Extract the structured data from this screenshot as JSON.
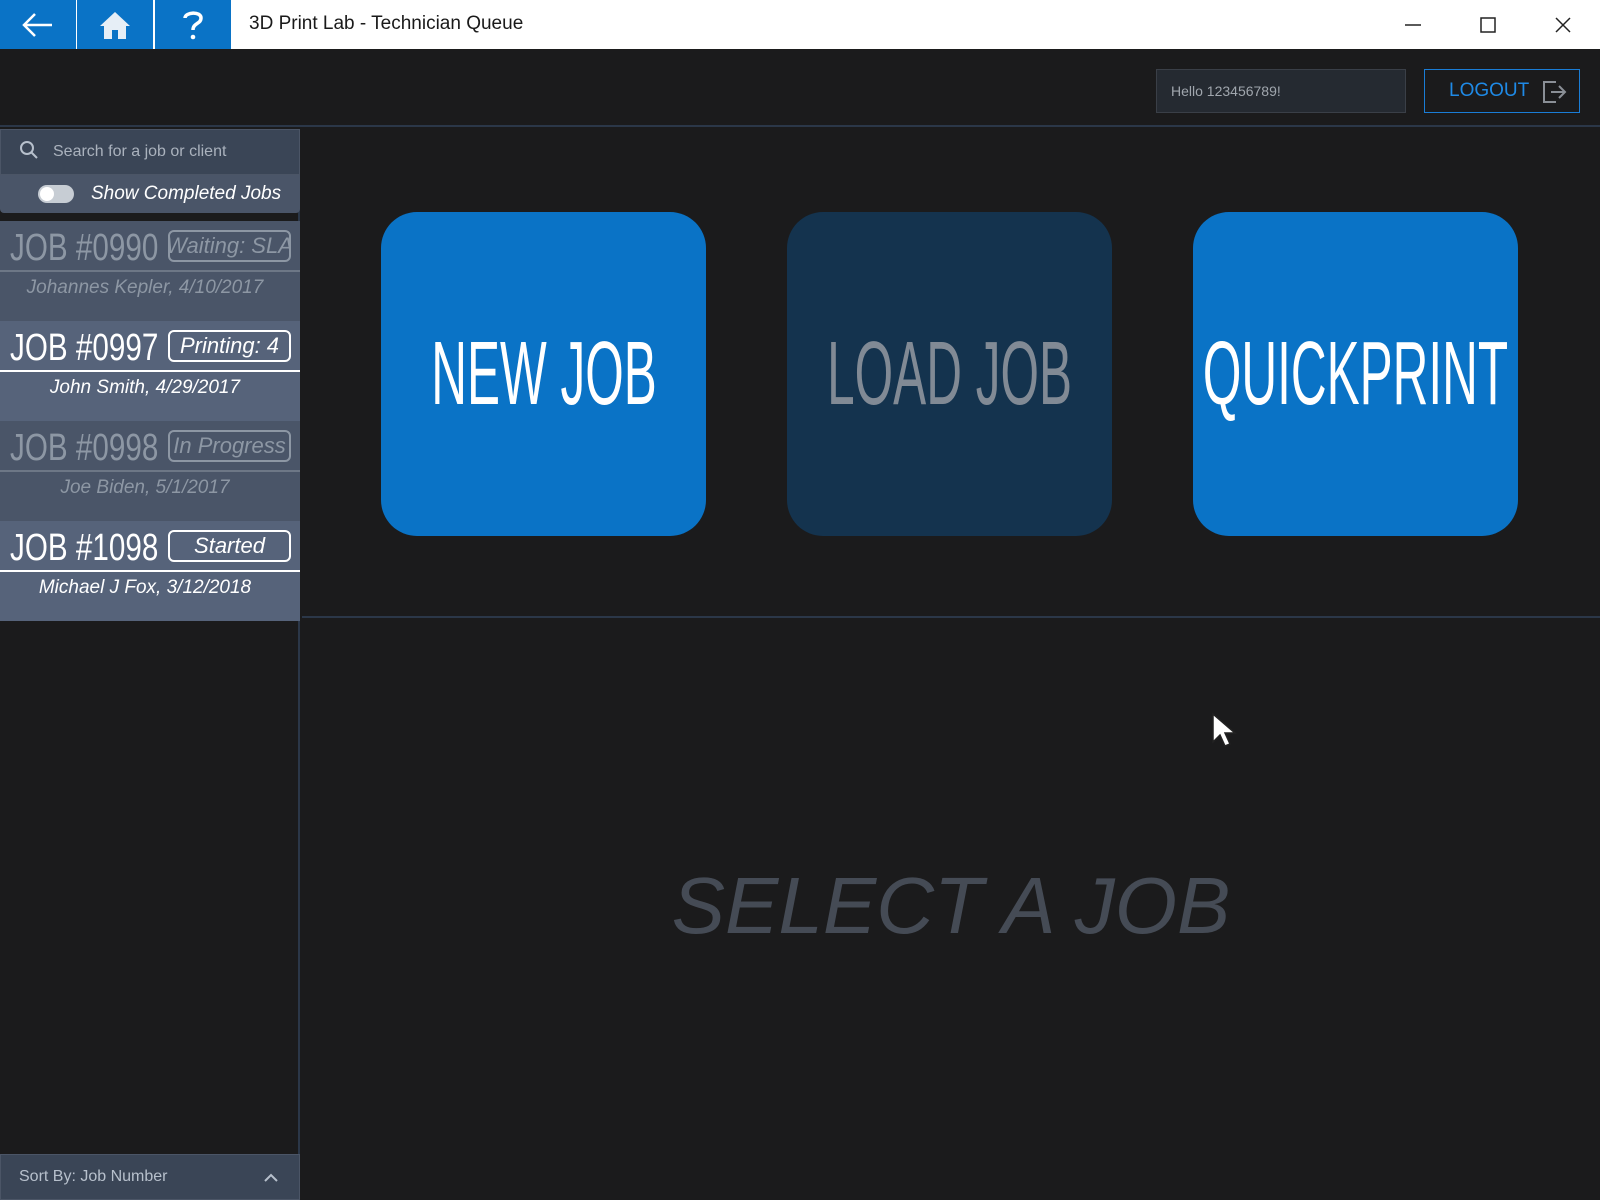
{
  "window": {
    "title": "3D Print Lab - Technician Queue",
    "nav_buttons": [
      "back-arrow-icon",
      "home-icon",
      "help-icon"
    ],
    "controls": [
      "minimize-icon",
      "maximize-icon",
      "close-icon"
    ]
  },
  "header": {
    "greeting": "Hello 123456789!",
    "logout_label": "LOGOUT"
  },
  "sidebar": {
    "search_placeholder": "Search for a job or client",
    "toggle_label": "Show Completed Jobs",
    "toggle_on": false,
    "jobs": [
      {
        "number": "JOB #0990",
        "status": "Waiting: SLA",
        "client": "Johannes Kepler, 4/10/2017",
        "state": "dim"
      },
      {
        "number": "JOB #0997",
        "status": "Printing: 4",
        "client": "John Smith, 4/29/2017",
        "state": "active"
      },
      {
        "number": "JOB #0998",
        "status": "In Progress",
        "client": "Joe Biden, 5/1/2017",
        "state": "dim"
      },
      {
        "number": "JOB #1098",
        "status": "Started",
        "client": "Michael J Fox, 3/12/2018",
        "state": "active"
      }
    ],
    "sort_label": "Sort By: Job Number"
  },
  "actions": {
    "new_job": "NEW JOB",
    "load_job": "LOAD JOB",
    "quickprint": "QUICKPRINT"
  },
  "detail": {
    "empty_message": "SELECT A JOB"
  },
  "colors": {
    "accent": "#0a73c6",
    "background": "#1b1b1c",
    "disabled_tile": "#14334e"
  }
}
